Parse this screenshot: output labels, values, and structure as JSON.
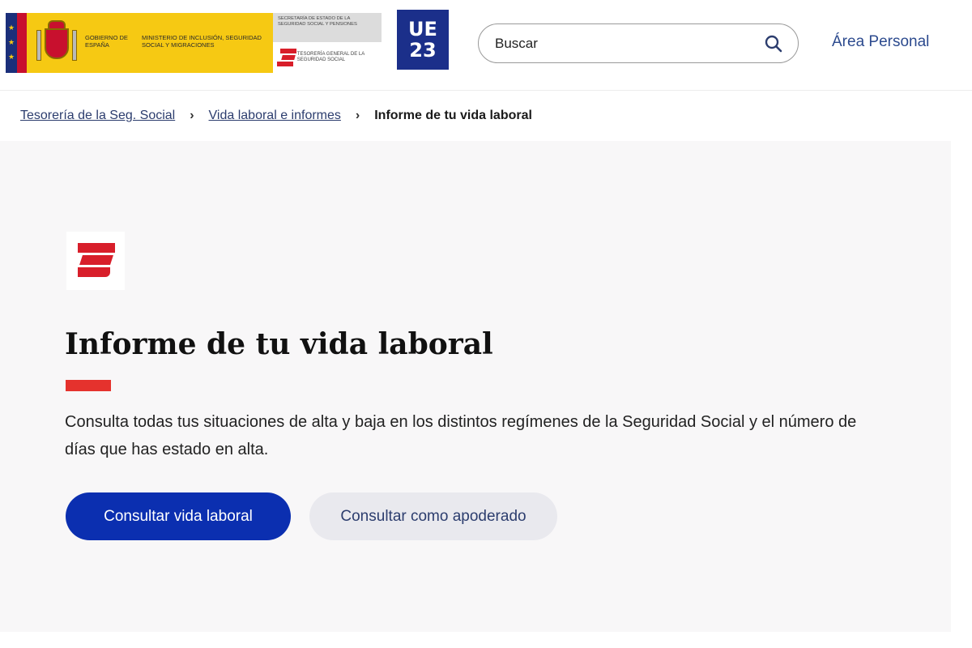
{
  "header": {
    "gov_label": "GOBIERNO DE ESPAÑA",
    "ministry_label": "MINISTERIO DE INCLUSIÓN, SEGURIDAD SOCIAL Y MIGRACIONES",
    "secretaria_label": "SECRETARÍA DE ESTADO DE LA SEGURIDAD SOCIAL Y PENSIONES",
    "tesoreria_label": "TESORERÍA GENERAL DE LA SEGURIDAD SOCIAL",
    "eu_badge_top": "UE",
    "eu_badge_bottom": "23",
    "search_placeholder": "Buscar",
    "area_personal_label": "Área Personal"
  },
  "breadcrumb": {
    "items": [
      {
        "label": "Tesorería de la Seg. Social"
      },
      {
        "label": "Vida laboral e informes"
      }
    ],
    "current": "Informe de tu vida laboral"
  },
  "main": {
    "title": "Informe de tu vida laboral",
    "description": "Consulta todas tus situaciones de alta y baja en los distintos regímenes de la Seguridad Social y el número de días que has estado en alta.",
    "primary_button": "Consultar vida laboral",
    "secondary_button": "Consultar como apoderado"
  },
  "colors": {
    "primary_blue": "#0b2fb0",
    "accent_red": "#e5322d",
    "link_blue": "#2c4a8e",
    "gov_yellow": "#f6c913"
  },
  "icons": {
    "search": "search-icon",
    "breadcrumb_separator": "chevron-right-icon"
  }
}
